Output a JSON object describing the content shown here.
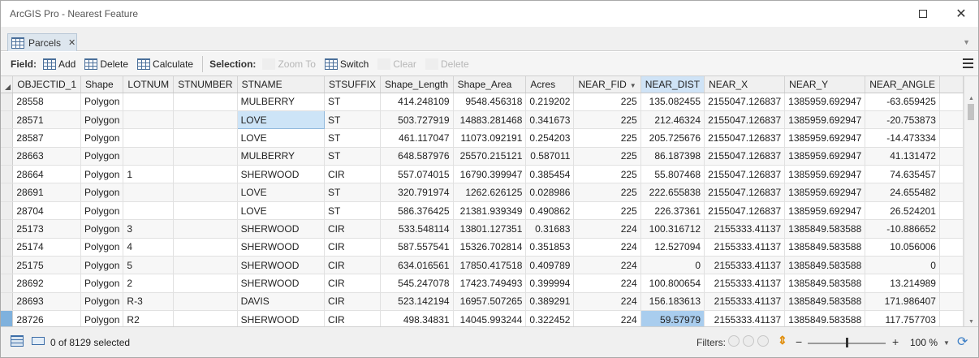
{
  "window": {
    "title": "ArcGIS Pro - Nearest Feature",
    "restore_label": "",
    "close_label": "✕"
  },
  "tab": {
    "label": "Parcels",
    "close": "✕"
  },
  "toolbar": {
    "field_label": "Field:",
    "add": "Add",
    "delete": "Delete",
    "calculate": "Calculate",
    "selection_label": "Selection:",
    "zoom_to": "Zoom To",
    "switch": "Switch",
    "clear": "Clear",
    "sel_delete": "Delete"
  },
  "table": {
    "columns": [
      "OBJECTID_1",
      "Shape",
      "LOTNUM",
      "STNUMBER",
      "STNAME",
      "STSUFFIX",
      "Shape_Length",
      "Shape_Area",
      "Acres",
      "NEAR_FID",
      "NEAR_DIST",
      "NEAR_X",
      "NEAR_Y",
      "NEAR_ANGLE"
    ],
    "sorted_column": "NEAR_DIST",
    "sort_indicator": "▼",
    "rows": [
      [
        "28558",
        "Polygon",
        "",
        "",
        "MULBERRY",
        "ST",
        "414.248109",
        "9548.456318",
        "0.219202",
        "225",
        "135.082455",
        "2155047.126837",
        "1385959.692947",
        "-63.659425"
      ],
      [
        "28571",
        "Polygon",
        "",
        "",
        "LOVE",
        "ST",
        "503.727919",
        "14883.281468",
        "0.341673",
        "225",
        "212.46324",
        "2155047.126837",
        "1385959.692947",
        "-20.753873"
      ],
      [
        "28587",
        "Polygon",
        "",
        "",
        "LOVE",
        "ST",
        "461.117047",
        "11073.092191",
        "0.254203",
        "225",
        "205.725676",
        "2155047.126837",
        "1385959.692947",
        "-14.473334"
      ],
      [
        "28663",
        "Polygon",
        "",
        "",
        "MULBERRY",
        "ST",
        "648.587976",
        "25570.215121",
        "0.587011",
        "225",
        "86.187398",
        "2155047.126837",
        "1385959.692947",
        "41.131472"
      ],
      [
        "28664",
        "Polygon",
        "1",
        "",
        "SHERWOOD",
        "CIR",
        "557.074015",
        "16790.399947",
        "0.385454",
        "225",
        "55.807468",
        "2155047.126837",
        "1385959.692947",
        "74.635457"
      ],
      [
        "28691",
        "Polygon",
        "",
        "",
        "LOVE",
        "ST",
        "320.791974",
        "1262.626125",
        "0.028986",
        "225",
        "222.655838",
        "2155047.126837",
        "1385959.692947",
        "24.655482"
      ],
      [
        "28704",
        "Polygon",
        "",
        "",
        "LOVE",
        "ST",
        "586.376425",
        "21381.939349",
        "0.490862",
        "225",
        "226.37361",
        "2155047.126837",
        "1385959.692947",
        "26.524201"
      ],
      [
        "25173",
        "Polygon",
        "3",
        "",
        "SHERWOOD",
        "CIR",
        "533.548114",
        "13801.127351",
        "0.31683",
        "224",
        "100.316712",
        "2155333.41137",
        "1385849.583588",
        "-10.886652"
      ],
      [
        "25174",
        "Polygon",
        "4",
        "",
        "SHERWOOD",
        "CIR",
        "587.557541",
        "15326.702814",
        "0.351853",
        "224",
        "12.527094",
        "2155333.41137",
        "1385849.583588",
        "10.056006"
      ],
      [
        "25175",
        "Polygon",
        "5",
        "",
        "SHERWOOD",
        "CIR",
        "634.016561",
        "17850.417518",
        "0.409789",
        "224",
        "0",
        "2155333.41137",
        "1385849.583588",
        "0"
      ],
      [
        "28692",
        "Polygon",
        "2",
        "",
        "SHERWOOD",
        "CIR",
        "545.247078",
        "17423.749493",
        "0.399994",
        "224",
        "100.800654",
        "2155333.41137",
        "1385849.583588",
        "13.214989"
      ],
      [
        "28693",
        "Polygon",
        "R-3",
        "",
        "DAVIS",
        "CIR",
        "523.142194",
        "16957.507265",
        "0.389291",
        "224",
        "156.183613",
        "2155333.41137",
        "1385849.583588",
        "171.986407"
      ],
      [
        "28726",
        "Polygon",
        "R2",
        "",
        "SHERWOOD",
        "CIR",
        "498.34831",
        "14045.993244",
        "0.322452",
        "224",
        "59.57979",
        "2155333.41137",
        "1385849.583588",
        "117.757703"
      ]
    ]
  },
  "statusbar": {
    "selected": "0 of 8129 selected",
    "filters_label": "Filters:",
    "zoom_minus": "−",
    "zoom_plus": "+",
    "zoom_level": "100 %"
  },
  "colors": {
    "header_bg": "#f0f0f0",
    "sorted_header": "#cfe3f6",
    "selection": "#7fb1dd",
    "accent": "#3d7fc6"
  }
}
